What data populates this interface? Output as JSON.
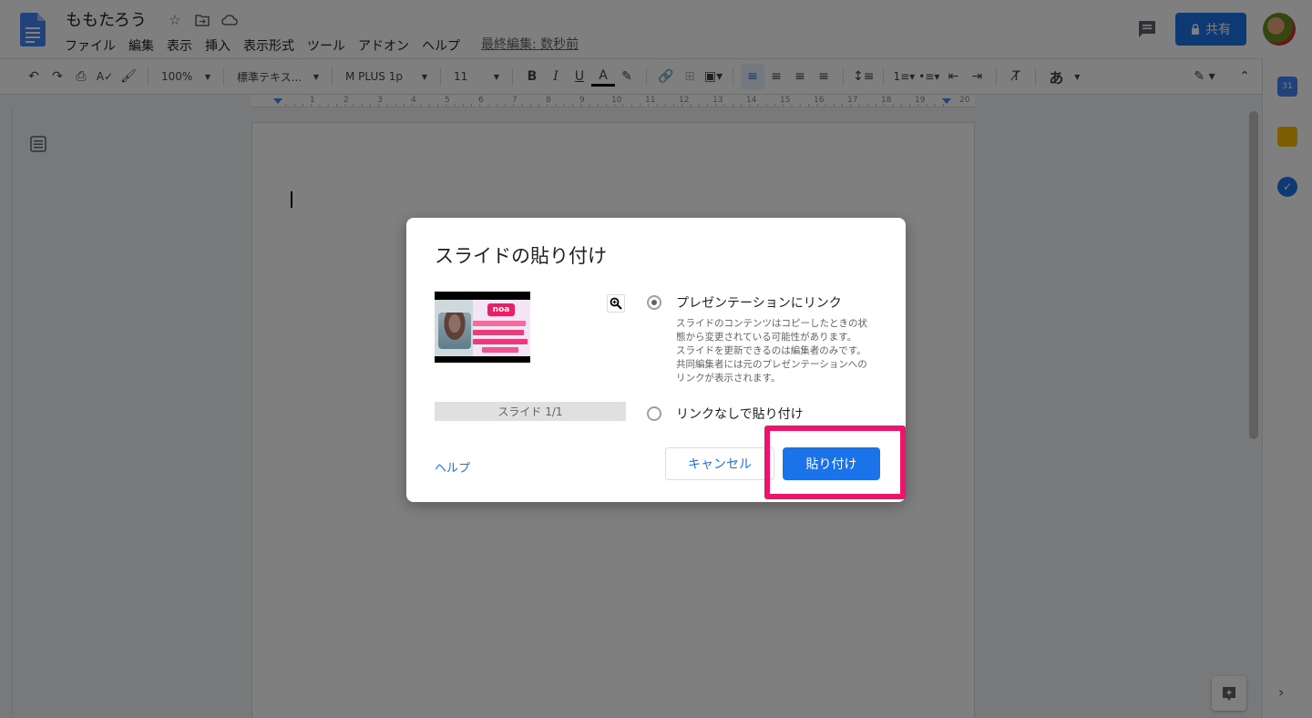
{
  "header": {
    "doc_title": "ももたろう",
    "last_edit": "最終編集: 数秒前",
    "share_label": "共有",
    "menu": [
      "ファイル",
      "編集",
      "表示",
      "挿入",
      "表示形式",
      "ツール",
      "アドオン",
      "ヘルプ"
    ]
  },
  "toolbar": {
    "zoom": "100%",
    "style": "標準テキス...",
    "font": "M PLUS 1p",
    "size": "11",
    "input_tool": "あ"
  },
  "ruler": {
    "marks": [
      "1",
      "2",
      "3",
      "4",
      "5",
      "6",
      "7",
      "8",
      "9",
      "10",
      "11",
      "12",
      "13",
      "14",
      "15",
      "16",
      "17",
      "18",
      "19",
      "20"
    ]
  },
  "dialog": {
    "title": "スライドの貼り付け",
    "thumb_logo": "noa",
    "slide_label": "スライド 1/1",
    "option_link": {
      "label": "プレゼンテーションにリンク",
      "description": "スライドのコンテンツはコピーしたときの状態から変更されている可能性があります。 スライドを更新できるのは編集者のみです。共同編集者には元のプレゼンテーションへのリンクが表示されます。",
      "checked": true
    },
    "option_nolink": {
      "label": "リンクなしで貼り付け",
      "checked": false
    },
    "help_label": "ヘルプ",
    "cancel_label": "キャンセル",
    "paste_label": "貼り付け"
  },
  "colors": {
    "accent": "#1a73e8",
    "highlight": "#f0136a",
    "overlay": "rgba(0,0,0,0.5)"
  }
}
